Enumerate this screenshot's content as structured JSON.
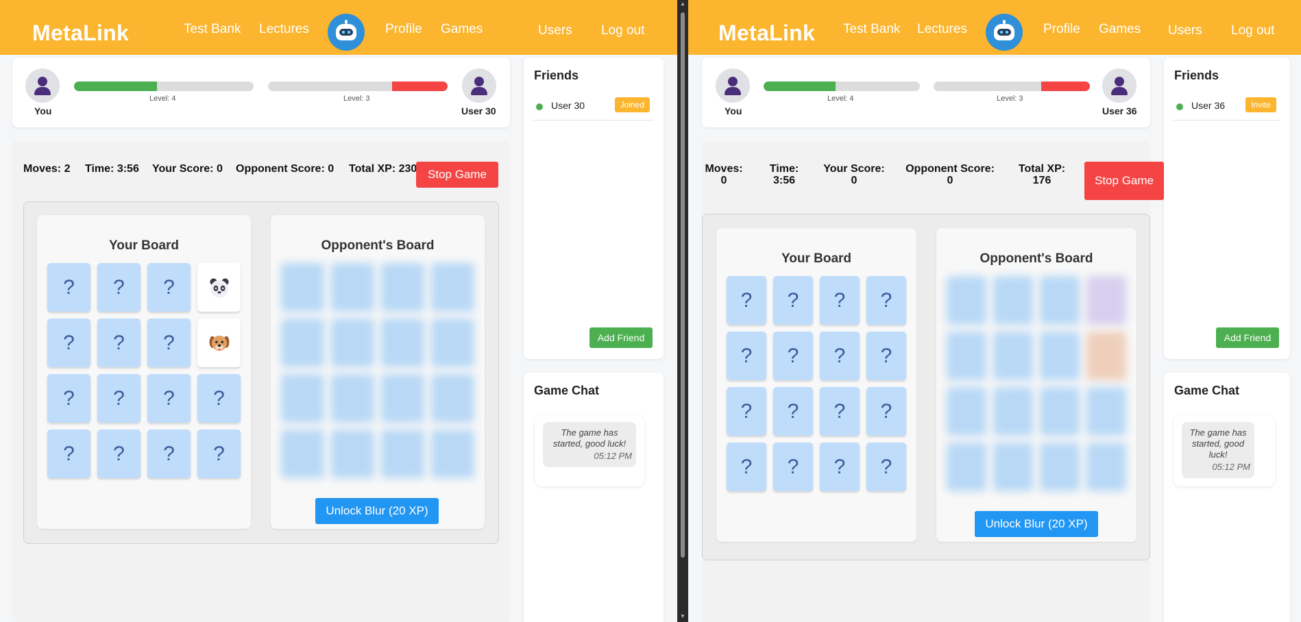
{
  "left": {
    "header": {
      "brand": "MetaLink",
      "nav": {
        "test_bank": "Test Bank",
        "lectures": "Lectures",
        "profile": "Profile",
        "games": "Games",
        "users": "Users",
        "logout": "Log out"
      }
    },
    "players": {
      "you": "You",
      "opponent": "User 30",
      "you_level": "Level: 4",
      "opponent_level": "Level: 3",
      "you_progress": 0.46,
      "opponent_progress": 0.31
    },
    "game": {
      "moves": "Moves: 2",
      "time": "Time: 3:56",
      "your_score": "Your Score: 0",
      "opponent_score": "Opponent Score: 0",
      "total_xp": "Total XP: 230",
      "stop": "Stop Game"
    },
    "your_board": {
      "title": "Your Board",
      "tiles": [
        "?",
        "?",
        "?",
        "panda-emoji",
        "?",
        "?",
        "?",
        "dog-emoji",
        "?",
        "?",
        "?",
        "?",
        "?",
        "?",
        "?",
        "?"
      ]
    },
    "opponent_board": {
      "title": "Opponent's Board",
      "unlock": "Unlock Blur (20 XP)"
    },
    "friends": {
      "title": "Friends",
      "items": [
        {
          "name": "User 30",
          "status": "Joined"
        }
      ],
      "add": "Add Friend"
    },
    "chat": {
      "title": "Game Chat",
      "messages": [
        {
          "text": "The game has started, good luck!",
          "time": "05:12 PM"
        }
      ]
    }
  },
  "right": {
    "header": {
      "brand": "MetaLink",
      "nav": {
        "test_bank": "Test Bank",
        "lectures": "Lectures",
        "profile": "Profile",
        "games": "Games",
        "users": "Users",
        "logout": "Log out"
      }
    },
    "players": {
      "you": "You",
      "opponent": "User 36",
      "you_level": "Level: 4",
      "opponent_level": "Level: 3",
      "you_progress": 0.46,
      "opponent_progress": 0.31
    },
    "game": {
      "moves_label": "Moves:",
      "moves": "0",
      "time_label": "Time:",
      "time": "3:56",
      "your_score_label": "Your Score:",
      "your_score": "0",
      "opponent_score_label": "Opponent Score:",
      "opponent_score": "0",
      "total_xp_label": "Total XP:",
      "total_xp": "176",
      "stop": "Stop Game"
    },
    "your_board": {
      "title": "Your Board",
      "tiles": [
        "?",
        "?",
        "?",
        "?",
        "?",
        "?",
        "?",
        "?",
        "?",
        "?",
        "?",
        "?",
        "?",
        "?",
        "?",
        "?"
      ]
    },
    "opponent_board": {
      "title": "Opponent's Board",
      "unlock": "Unlock Blur (20 XP)"
    },
    "friends": {
      "title": "Friends",
      "items": [
        {
          "name": "User 36",
          "status": "Invite"
        }
      ],
      "add": "Add Friend"
    },
    "chat": {
      "title": "Game Chat",
      "messages": [
        {
          "text": "The game has started, good luck!",
          "time": "05:12 PM"
        }
      ]
    }
  },
  "colors": {
    "header": "#fbb52e",
    "xp_bar": "#4caf50",
    "opponent_bar": "#f44444",
    "tile": "#bfdcfb",
    "stop": "#f44444",
    "unlock": "#2196f3",
    "add_friend": "#4caf50"
  }
}
